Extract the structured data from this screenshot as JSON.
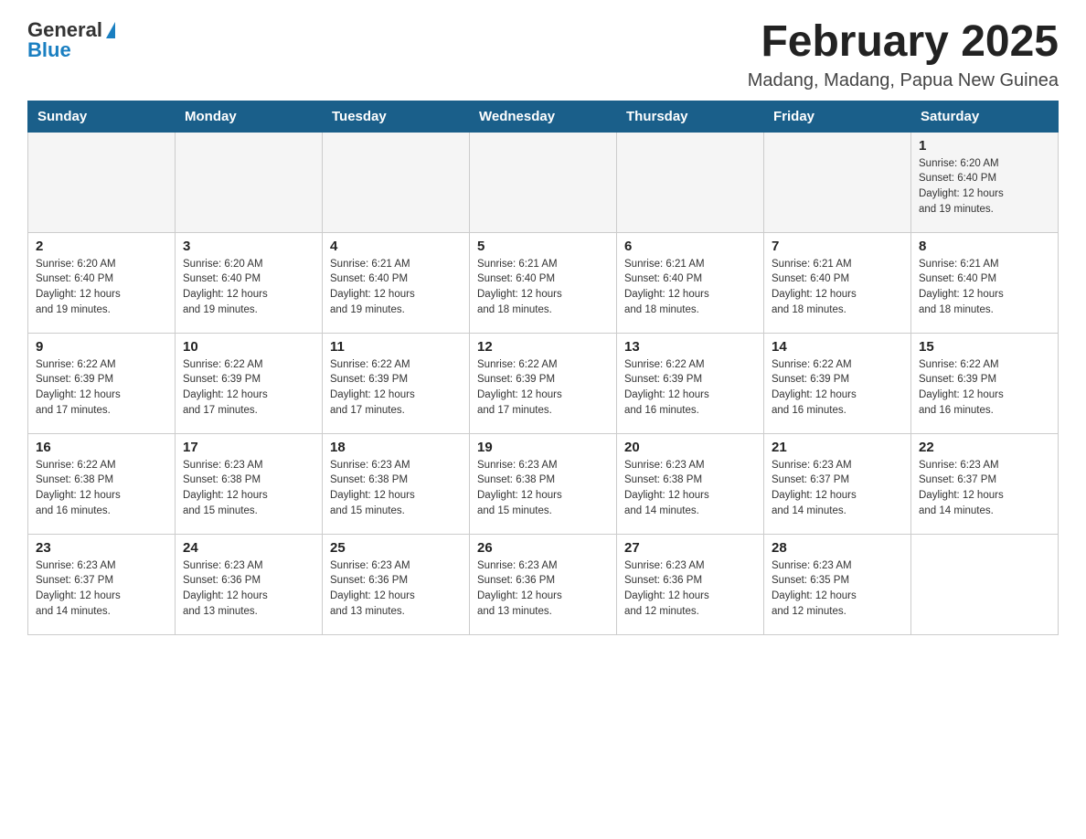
{
  "header": {
    "logo_general": "General",
    "logo_blue": "Blue",
    "month_title": "February 2025",
    "location": "Madang, Madang, Papua New Guinea"
  },
  "weekdays": [
    "Sunday",
    "Monday",
    "Tuesday",
    "Wednesday",
    "Thursday",
    "Friday",
    "Saturday"
  ],
  "weeks": [
    [
      {
        "day": "",
        "info": ""
      },
      {
        "day": "",
        "info": ""
      },
      {
        "day": "",
        "info": ""
      },
      {
        "day": "",
        "info": ""
      },
      {
        "day": "",
        "info": ""
      },
      {
        "day": "",
        "info": ""
      },
      {
        "day": "1",
        "info": "Sunrise: 6:20 AM\nSunset: 6:40 PM\nDaylight: 12 hours\nand 19 minutes."
      }
    ],
    [
      {
        "day": "2",
        "info": "Sunrise: 6:20 AM\nSunset: 6:40 PM\nDaylight: 12 hours\nand 19 minutes."
      },
      {
        "day": "3",
        "info": "Sunrise: 6:20 AM\nSunset: 6:40 PM\nDaylight: 12 hours\nand 19 minutes."
      },
      {
        "day": "4",
        "info": "Sunrise: 6:21 AM\nSunset: 6:40 PM\nDaylight: 12 hours\nand 19 minutes."
      },
      {
        "day": "5",
        "info": "Sunrise: 6:21 AM\nSunset: 6:40 PM\nDaylight: 12 hours\nand 18 minutes."
      },
      {
        "day": "6",
        "info": "Sunrise: 6:21 AM\nSunset: 6:40 PM\nDaylight: 12 hours\nand 18 minutes."
      },
      {
        "day": "7",
        "info": "Sunrise: 6:21 AM\nSunset: 6:40 PM\nDaylight: 12 hours\nand 18 minutes."
      },
      {
        "day": "8",
        "info": "Sunrise: 6:21 AM\nSunset: 6:40 PM\nDaylight: 12 hours\nand 18 minutes."
      }
    ],
    [
      {
        "day": "9",
        "info": "Sunrise: 6:22 AM\nSunset: 6:39 PM\nDaylight: 12 hours\nand 17 minutes."
      },
      {
        "day": "10",
        "info": "Sunrise: 6:22 AM\nSunset: 6:39 PM\nDaylight: 12 hours\nand 17 minutes."
      },
      {
        "day": "11",
        "info": "Sunrise: 6:22 AM\nSunset: 6:39 PM\nDaylight: 12 hours\nand 17 minutes."
      },
      {
        "day": "12",
        "info": "Sunrise: 6:22 AM\nSunset: 6:39 PM\nDaylight: 12 hours\nand 17 minutes."
      },
      {
        "day": "13",
        "info": "Sunrise: 6:22 AM\nSunset: 6:39 PM\nDaylight: 12 hours\nand 16 minutes."
      },
      {
        "day": "14",
        "info": "Sunrise: 6:22 AM\nSunset: 6:39 PM\nDaylight: 12 hours\nand 16 minutes."
      },
      {
        "day": "15",
        "info": "Sunrise: 6:22 AM\nSunset: 6:39 PM\nDaylight: 12 hours\nand 16 minutes."
      }
    ],
    [
      {
        "day": "16",
        "info": "Sunrise: 6:22 AM\nSunset: 6:38 PM\nDaylight: 12 hours\nand 16 minutes."
      },
      {
        "day": "17",
        "info": "Sunrise: 6:23 AM\nSunset: 6:38 PM\nDaylight: 12 hours\nand 15 minutes."
      },
      {
        "day": "18",
        "info": "Sunrise: 6:23 AM\nSunset: 6:38 PM\nDaylight: 12 hours\nand 15 minutes."
      },
      {
        "day": "19",
        "info": "Sunrise: 6:23 AM\nSunset: 6:38 PM\nDaylight: 12 hours\nand 15 minutes."
      },
      {
        "day": "20",
        "info": "Sunrise: 6:23 AM\nSunset: 6:38 PM\nDaylight: 12 hours\nand 14 minutes."
      },
      {
        "day": "21",
        "info": "Sunrise: 6:23 AM\nSunset: 6:37 PM\nDaylight: 12 hours\nand 14 minutes."
      },
      {
        "day": "22",
        "info": "Sunrise: 6:23 AM\nSunset: 6:37 PM\nDaylight: 12 hours\nand 14 minutes."
      }
    ],
    [
      {
        "day": "23",
        "info": "Sunrise: 6:23 AM\nSunset: 6:37 PM\nDaylight: 12 hours\nand 14 minutes."
      },
      {
        "day": "24",
        "info": "Sunrise: 6:23 AM\nSunset: 6:36 PM\nDaylight: 12 hours\nand 13 minutes."
      },
      {
        "day": "25",
        "info": "Sunrise: 6:23 AM\nSunset: 6:36 PM\nDaylight: 12 hours\nand 13 minutes."
      },
      {
        "day": "26",
        "info": "Sunrise: 6:23 AM\nSunset: 6:36 PM\nDaylight: 12 hours\nand 13 minutes."
      },
      {
        "day": "27",
        "info": "Sunrise: 6:23 AM\nSunset: 6:36 PM\nDaylight: 12 hours\nand 12 minutes."
      },
      {
        "day": "28",
        "info": "Sunrise: 6:23 AM\nSunset: 6:35 PM\nDaylight: 12 hours\nand 12 minutes."
      },
      {
        "day": "",
        "info": ""
      }
    ]
  ]
}
